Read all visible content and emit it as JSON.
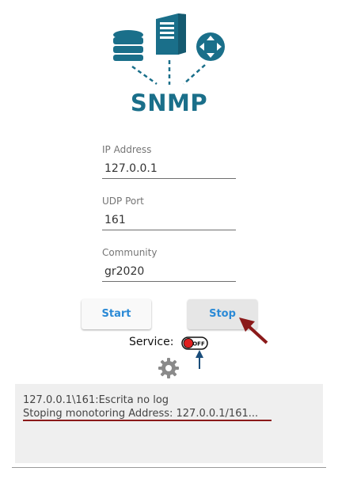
{
  "logo": {
    "text": "SNMP",
    "color": "#1a6f8a"
  },
  "fields": [
    {
      "label": "IP Address",
      "value": "127.0.0.1"
    },
    {
      "label": "UDP Port",
      "value": "161"
    },
    {
      "label": "Community",
      "value": "gr2020"
    }
  ],
  "buttons": {
    "start": "Start",
    "stop": "Stop"
  },
  "service": {
    "label": "Service:",
    "state": "OFF",
    "icon": "toggle-off-icon"
  },
  "settings_icon": "gear-icon",
  "log": {
    "lines": [
      "127.0.0.1\\161:Escrita no log",
      "Stoping monotoring Address: 127.0.0.1/161..."
    ]
  },
  "colors": {
    "accent": "#2b8ad6",
    "annotation": "#8b1a1a",
    "pointer": "#1a4d7a"
  }
}
